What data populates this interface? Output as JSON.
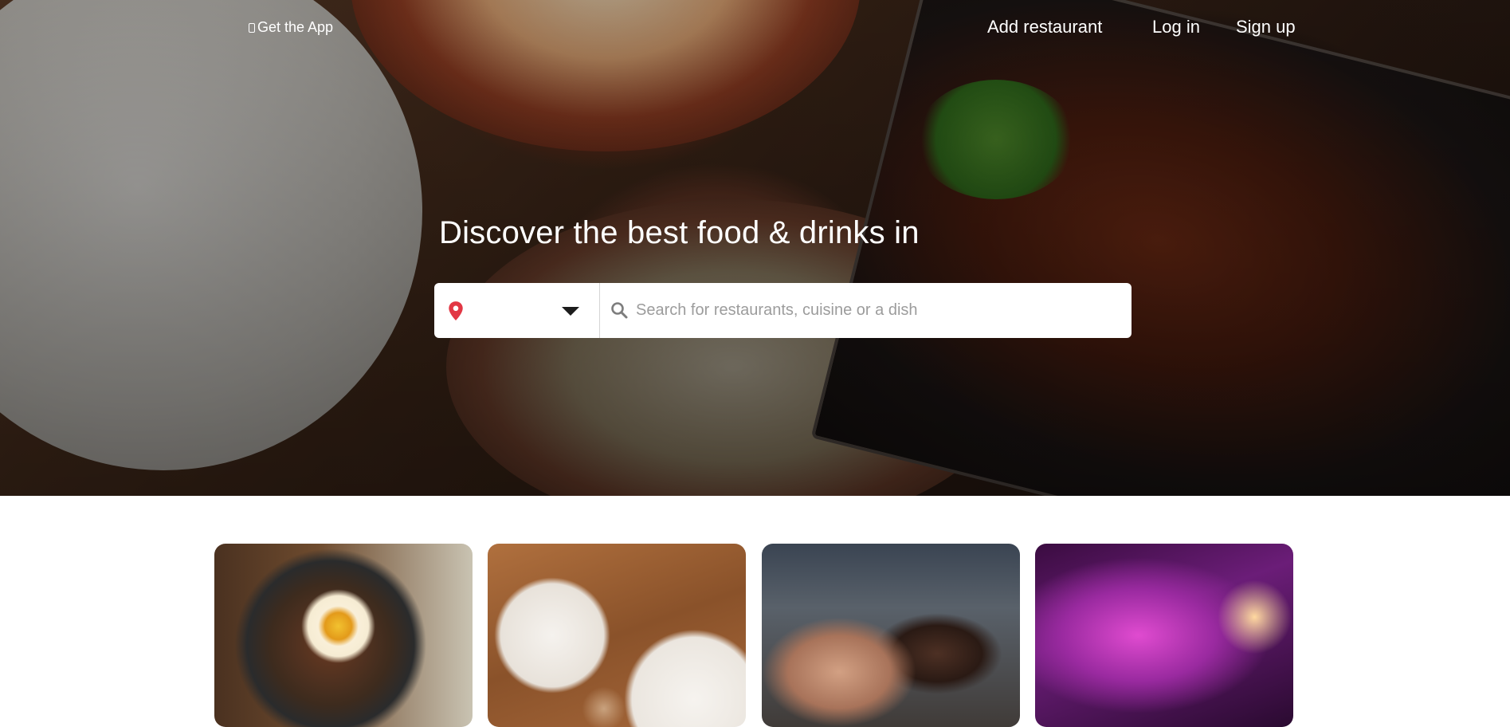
{
  "header": {
    "get_app_label": "Get the App",
    "nav": {
      "add_restaurant": "Add restaurant",
      "log_in": "Log in",
      "sign_up": "Sign up"
    }
  },
  "hero": {
    "headline": "Discover the best food & drinks in"
  },
  "search": {
    "location_value": "",
    "location_icon": "map-pin-icon",
    "dropdown_icon": "caret-down-icon",
    "query_placeholder": "Search for restaurants, cuisine or a dish",
    "query_icon": "search-icon"
  },
  "colors": {
    "pin_accent": "#e23744",
    "text_on_hero": "#ffffff",
    "placeholder": "#9c9c9c"
  },
  "cards": [
    {
      "name": "bowl-dish-card"
    },
    {
      "name": "breakfast-table-card"
    },
    {
      "name": "friends-toasting-card"
    },
    {
      "name": "cocktail-bar-card"
    }
  ]
}
